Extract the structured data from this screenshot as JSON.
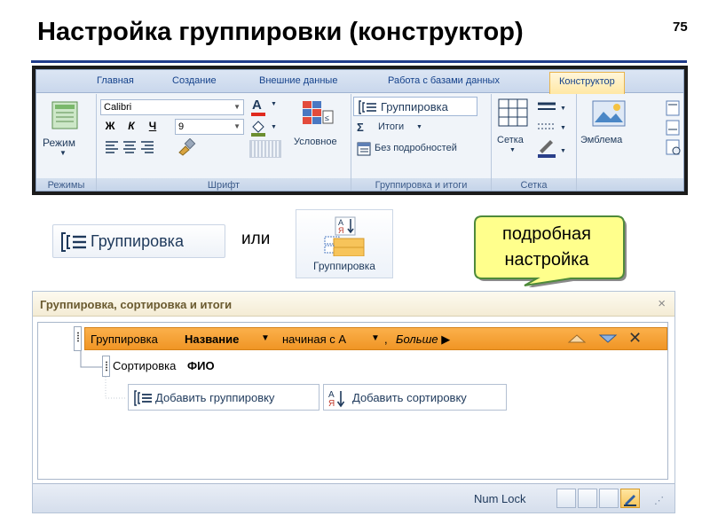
{
  "slide": {
    "title": "Настройка группировки (конструктор)",
    "number": "75"
  },
  "ribbon": {
    "tabs": [
      "Главная",
      "Создание",
      "Внешние данные",
      "Работа с базами данных",
      "Конструктор"
    ],
    "views": {
      "mode_label": "Режим",
      "group_label": "Режимы"
    },
    "font": {
      "font_name": "Calibri",
      "bold": "Ж",
      "italic": "К",
      "underline": "Ч",
      "font_size": "9",
      "font_color_letter": "А",
      "conditional_label": "Условное",
      "group_label": "Шрифт"
    },
    "grouping": {
      "group_btn": "Группировка",
      "totals_btn": "Итоги",
      "totals_symbol": "Σ",
      "hide_details_btn": "Без подробностей",
      "group_label": "Группировка и итоги"
    },
    "gridlines": {
      "grid_btn": "Сетка",
      "group_label": "Сетка"
    },
    "controls": {
      "logo_btn": "Эмблема"
    }
  },
  "middle": {
    "group_wide_label": "Группировка",
    "or_text": "или",
    "group_big_label": "Группировка",
    "callout_line1": "подробная",
    "callout_line2": "настройка"
  },
  "pane": {
    "title": "Группировка, сортировка и итоги",
    "close_symbol": "×",
    "group_row": {
      "prefix": "Группировка",
      "field": "Название",
      "order": "начиная с А",
      "comma": ",",
      "more": "Больше ▶"
    },
    "sort_row": {
      "prefix": "Сортировка",
      "field": "ФИО"
    },
    "add_group_label": "Добавить группировку",
    "add_sort_label": "Добавить сортировку",
    "status_text": "Num Lock"
  },
  "colors": {
    "accent": "#1f3b8a",
    "group_row": "#f5a23a",
    "active_tab": "#ffe8a5"
  }
}
